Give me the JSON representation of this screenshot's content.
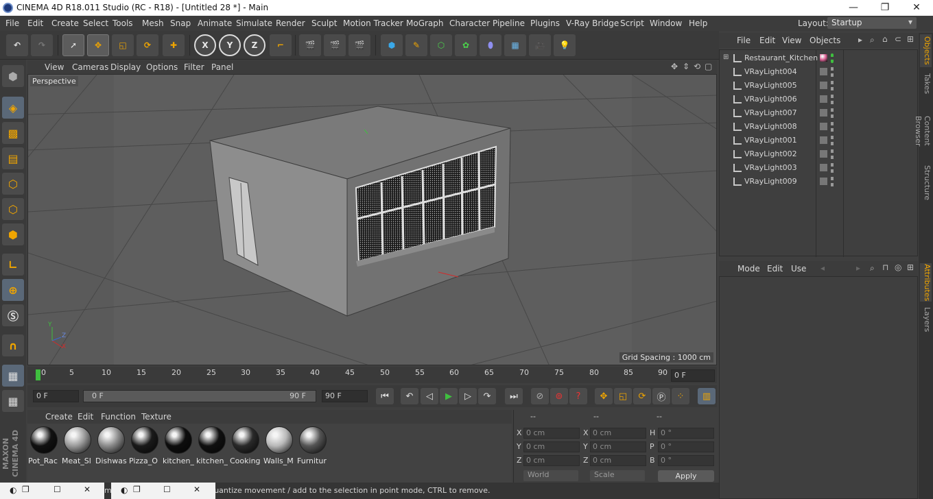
{
  "window": {
    "title": "CINEMA 4D R18.011 Studio (RC - R18) - [Untitled 28 *] - Main",
    "minimize": "—",
    "restore": "❐",
    "close": "✕"
  },
  "menu": [
    "File",
    "Edit",
    "Create",
    "Select",
    "Tools",
    "Mesh",
    "Snap",
    "Animate",
    "Simulate",
    "Render",
    "Sculpt",
    "Motion Tracker",
    "MoGraph",
    "Character",
    "Pipeline",
    "Plugins",
    "V-Ray Bridge",
    "Script",
    "Window",
    "Help"
  ],
  "layout": {
    "label": "Layout:",
    "value": "Startup"
  },
  "toolbar": {
    "axis_x": "X",
    "axis_y": "Y",
    "axis_z": "Z"
  },
  "viewport": {
    "menu": [
      "View",
      "Cameras",
      "Display",
      "Options",
      "Filter",
      "Panel"
    ],
    "label": "Perspective",
    "grid_spacing": "Grid Spacing : 1000 cm",
    "axis_labels": {
      "x": "X",
      "y": "Y",
      "z": "Z"
    }
  },
  "timeline": {
    "ticks": [
      "0",
      "5",
      "10",
      "15",
      "20",
      "25",
      "30",
      "35",
      "40",
      "45",
      "50",
      "55",
      "60",
      "65",
      "70",
      "75",
      "80",
      "85",
      "90"
    ],
    "current_frame": "0 F",
    "start": "0 F",
    "range_start": "0 F",
    "range_end": "90 F",
    "end": "90 F"
  },
  "materials": {
    "menu": [
      "Create",
      "Edit",
      "Function",
      "Texture"
    ],
    "items": [
      {
        "label": "Pot_Rac",
        "color": "#111111"
      },
      {
        "label": "Meat_Sl",
        "color": "#9a9a9a"
      },
      {
        "label": "Dishwas",
        "color": "#8b8b8b"
      },
      {
        "label": "Pizza_O",
        "color": "#1a1a1a"
      },
      {
        "label": "kitchen_",
        "color": "#0d0d0d"
      },
      {
        "label": "kitchen_",
        "color": "#101010"
      },
      {
        "label": "Cooking",
        "color": "#2a2a2a"
      },
      {
        "label": "Walls_M",
        "color": "#b8b8b8"
      },
      {
        "label": "Furnitur",
        "color": "#555555"
      }
    ]
  },
  "coordinates": {
    "headers": [
      "--",
      "--",
      "--"
    ],
    "rows": [
      {
        "a": "X",
        "av": "0 cm",
        "b": "X",
        "bv": "0 cm",
        "c": "H",
        "cv": "0 °"
      },
      {
        "a": "Y",
        "av": "0 cm",
        "b": "Y",
        "bv": "0 cm",
        "c": "P",
        "cv": "0 °"
      },
      {
        "a": "Z",
        "av": "0 cm",
        "b": "Z",
        "bv": "0 cm",
        "c": "B",
        "cv": "0 °"
      }
    ],
    "mode": "World",
    "scale": "Scale",
    "apply": "Apply"
  },
  "status": "mo                              FT to quantize movement / add to the selection in point mode, CTRL to remove.",
  "objects": {
    "menu": [
      "File",
      "Edit",
      "View",
      "Objects"
    ],
    "items": [
      {
        "name": "Restaurant_Kitchen",
        "tag": "#e0679a"
      },
      {
        "name": "VRayLight004"
      },
      {
        "name": "VRayLight005"
      },
      {
        "name": "VRayLight006"
      },
      {
        "name": "VRayLight007"
      },
      {
        "name": "VRayLight008"
      },
      {
        "name": "VRayLight001"
      },
      {
        "name": "VRayLight002"
      },
      {
        "name": "VRayLight003"
      },
      {
        "name": "VRayLight009"
      }
    ]
  },
  "attributes": {
    "menu": [
      "Mode",
      "Edit",
      "Use"
    ]
  },
  "side_tabs": [
    "Objects",
    "Takes",
    "Content Browser",
    "Structure",
    "Attributes",
    "Layers"
  ]
}
